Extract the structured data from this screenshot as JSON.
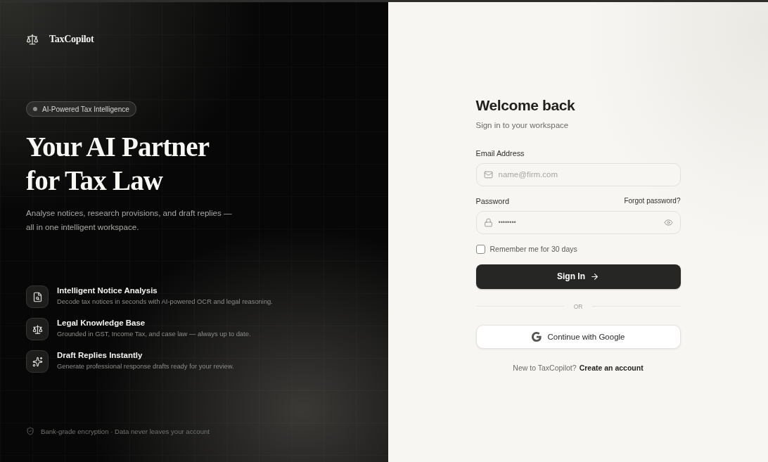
{
  "brand": {
    "name": "TaxCopilot"
  },
  "hero": {
    "badge": "AI-Powered Tax Intelligence",
    "headline": "Your AI Partner for Tax Law",
    "subtitle": "Analyse notices, research provisions, and draft replies — all in one intelligent workspace."
  },
  "features": [
    {
      "kind": "notice",
      "title": "Intelligent Notice Analysis",
      "description": "Decode tax notices in seconds with AI-powered OCR and legal reasoning."
    },
    {
      "kind": "knowledge",
      "title": "Legal Knowledge Base",
      "description": "Grounded in GST, Income Tax, and case law — always up to date."
    },
    {
      "kind": "draft",
      "title": "Draft Replies Instantly",
      "description": "Generate professional response drafts ready for your review."
    }
  ],
  "security_note": "Bank-grade encryption · Data never leaves your account",
  "login": {
    "title": "Welcome back",
    "subtitle": "Sign in to your workspace",
    "fields": [
      {
        "kind": "email",
        "label": "Email Address",
        "placeholder": "name@firm.com"
      },
      {
        "kind": "password",
        "label": "Password",
        "link": "Forgot password?",
        "placeholder": "••••••••"
      }
    ],
    "remember": {
      "label": "Remember me for 30 days",
      "checked": false
    },
    "submit": "Sign In",
    "divider": "OR",
    "google": "Continue with Google",
    "signup": {
      "prompt": "New to TaxCopilot?",
      "link": "Create an account"
    }
  }
}
